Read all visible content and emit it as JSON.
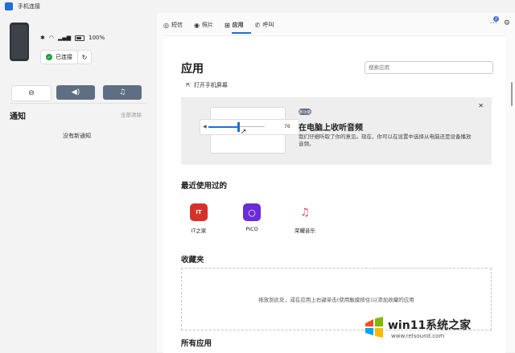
{
  "window": {
    "title": "手机连接"
  },
  "device": {
    "battery": "100%",
    "status_label": "已连接"
  },
  "notifications": {
    "title": "通知",
    "clear_all": "全部清除",
    "empty": "没有新通知"
  },
  "tabs": [
    {
      "label": "短信",
      "icon": "message-icon"
    },
    {
      "label": "照片",
      "icon": "photo-icon"
    },
    {
      "label": "应用",
      "icon": "apps-icon",
      "active": true
    },
    {
      "label": "呼叫",
      "icon": "phone-call-icon"
    }
  ],
  "badge_count": "2",
  "page": {
    "title": "应用",
    "search_placeholder": "搜索应用",
    "open_screen": "打开手机屏幕"
  },
  "banner": {
    "pill": "新功能",
    "title": "在电脑上收听音频",
    "desc": "我们仔细听取了你的意见。现在，你可以在设置中选择从电脑还是设备播放音频。",
    "volume": "76"
  },
  "recent": {
    "title": "最近使用过的",
    "apps": [
      {
        "label": "IT之家",
        "tile_text": "IT",
        "color": "#d6302b"
      },
      {
        "label": "PICO",
        "tile_text": "○",
        "color": "#6a2bd8"
      },
      {
        "label": "荣耀音乐",
        "tile_text": "♫",
        "color": "#ffffff"
      }
    ]
  },
  "favorites": {
    "title": "收藏夹",
    "hint": "拖放到此处，或在应用上右键单击(使用触摸按住)以添加收藏的应用"
  },
  "all_apps": {
    "title": "所有应用"
  },
  "watermark": {
    "text": "win11系统之家",
    "url": "www.relsound.com"
  }
}
